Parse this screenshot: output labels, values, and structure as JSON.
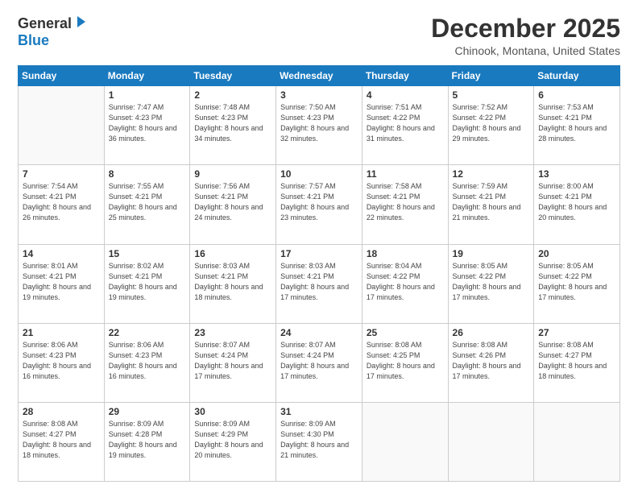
{
  "header": {
    "logo_general": "General",
    "logo_blue": "Blue",
    "month_title": "December 2025",
    "location": "Chinook, Montana, United States"
  },
  "weekdays": [
    "Sunday",
    "Monday",
    "Tuesday",
    "Wednesday",
    "Thursday",
    "Friday",
    "Saturday"
  ],
  "weeks": [
    [
      {
        "day": "",
        "sunrise": "",
        "sunset": "",
        "daylight": ""
      },
      {
        "day": "1",
        "sunrise": "Sunrise: 7:47 AM",
        "sunset": "Sunset: 4:23 PM",
        "daylight": "Daylight: 8 hours and 36 minutes."
      },
      {
        "day": "2",
        "sunrise": "Sunrise: 7:48 AM",
        "sunset": "Sunset: 4:23 PM",
        "daylight": "Daylight: 8 hours and 34 minutes."
      },
      {
        "day": "3",
        "sunrise": "Sunrise: 7:50 AM",
        "sunset": "Sunset: 4:23 PM",
        "daylight": "Daylight: 8 hours and 32 minutes."
      },
      {
        "day": "4",
        "sunrise": "Sunrise: 7:51 AM",
        "sunset": "Sunset: 4:22 PM",
        "daylight": "Daylight: 8 hours and 31 minutes."
      },
      {
        "day": "5",
        "sunrise": "Sunrise: 7:52 AM",
        "sunset": "Sunset: 4:22 PM",
        "daylight": "Daylight: 8 hours and 29 minutes."
      },
      {
        "day": "6",
        "sunrise": "Sunrise: 7:53 AM",
        "sunset": "Sunset: 4:21 PM",
        "daylight": "Daylight: 8 hours and 28 minutes."
      }
    ],
    [
      {
        "day": "7",
        "sunrise": "Sunrise: 7:54 AM",
        "sunset": "Sunset: 4:21 PM",
        "daylight": "Daylight: 8 hours and 26 minutes."
      },
      {
        "day": "8",
        "sunrise": "Sunrise: 7:55 AM",
        "sunset": "Sunset: 4:21 PM",
        "daylight": "Daylight: 8 hours and 25 minutes."
      },
      {
        "day": "9",
        "sunrise": "Sunrise: 7:56 AM",
        "sunset": "Sunset: 4:21 PM",
        "daylight": "Daylight: 8 hours and 24 minutes."
      },
      {
        "day": "10",
        "sunrise": "Sunrise: 7:57 AM",
        "sunset": "Sunset: 4:21 PM",
        "daylight": "Daylight: 8 hours and 23 minutes."
      },
      {
        "day": "11",
        "sunrise": "Sunrise: 7:58 AM",
        "sunset": "Sunset: 4:21 PM",
        "daylight": "Daylight: 8 hours and 22 minutes."
      },
      {
        "day": "12",
        "sunrise": "Sunrise: 7:59 AM",
        "sunset": "Sunset: 4:21 PM",
        "daylight": "Daylight: 8 hours and 21 minutes."
      },
      {
        "day": "13",
        "sunrise": "Sunrise: 8:00 AM",
        "sunset": "Sunset: 4:21 PM",
        "daylight": "Daylight: 8 hours and 20 minutes."
      }
    ],
    [
      {
        "day": "14",
        "sunrise": "Sunrise: 8:01 AM",
        "sunset": "Sunset: 4:21 PM",
        "daylight": "Daylight: 8 hours and 19 minutes."
      },
      {
        "day": "15",
        "sunrise": "Sunrise: 8:02 AM",
        "sunset": "Sunset: 4:21 PM",
        "daylight": "Daylight: 8 hours and 19 minutes."
      },
      {
        "day": "16",
        "sunrise": "Sunrise: 8:03 AM",
        "sunset": "Sunset: 4:21 PM",
        "daylight": "Daylight: 8 hours and 18 minutes."
      },
      {
        "day": "17",
        "sunrise": "Sunrise: 8:03 AM",
        "sunset": "Sunset: 4:21 PM",
        "daylight": "Daylight: 8 hours and 17 minutes."
      },
      {
        "day": "18",
        "sunrise": "Sunrise: 8:04 AM",
        "sunset": "Sunset: 4:22 PM",
        "daylight": "Daylight: 8 hours and 17 minutes."
      },
      {
        "day": "19",
        "sunrise": "Sunrise: 8:05 AM",
        "sunset": "Sunset: 4:22 PM",
        "daylight": "Daylight: 8 hours and 17 minutes."
      },
      {
        "day": "20",
        "sunrise": "Sunrise: 8:05 AM",
        "sunset": "Sunset: 4:22 PM",
        "daylight": "Daylight: 8 hours and 17 minutes."
      }
    ],
    [
      {
        "day": "21",
        "sunrise": "Sunrise: 8:06 AM",
        "sunset": "Sunset: 4:23 PM",
        "daylight": "Daylight: 8 hours and 16 minutes."
      },
      {
        "day": "22",
        "sunrise": "Sunrise: 8:06 AM",
        "sunset": "Sunset: 4:23 PM",
        "daylight": "Daylight: 8 hours and 16 minutes."
      },
      {
        "day": "23",
        "sunrise": "Sunrise: 8:07 AM",
        "sunset": "Sunset: 4:24 PM",
        "daylight": "Daylight: 8 hours and 17 minutes."
      },
      {
        "day": "24",
        "sunrise": "Sunrise: 8:07 AM",
        "sunset": "Sunset: 4:24 PM",
        "daylight": "Daylight: 8 hours and 17 minutes."
      },
      {
        "day": "25",
        "sunrise": "Sunrise: 8:08 AM",
        "sunset": "Sunset: 4:25 PM",
        "daylight": "Daylight: 8 hours and 17 minutes."
      },
      {
        "day": "26",
        "sunrise": "Sunrise: 8:08 AM",
        "sunset": "Sunset: 4:26 PM",
        "daylight": "Daylight: 8 hours and 17 minutes."
      },
      {
        "day": "27",
        "sunrise": "Sunrise: 8:08 AM",
        "sunset": "Sunset: 4:27 PM",
        "daylight": "Daylight: 8 hours and 18 minutes."
      }
    ],
    [
      {
        "day": "28",
        "sunrise": "Sunrise: 8:08 AM",
        "sunset": "Sunset: 4:27 PM",
        "daylight": "Daylight: 8 hours and 18 minutes."
      },
      {
        "day": "29",
        "sunrise": "Sunrise: 8:09 AM",
        "sunset": "Sunset: 4:28 PM",
        "daylight": "Daylight: 8 hours and 19 minutes."
      },
      {
        "day": "30",
        "sunrise": "Sunrise: 8:09 AM",
        "sunset": "Sunset: 4:29 PM",
        "daylight": "Daylight: 8 hours and 20 minutes."
      },
      {
        "day": "31",
        "sunrise": "Sunrise: 8:09 AM",
        "sunset": "Sunset: 4:30 PM",
        "daylight": "Daylight: 8 hours and 21 minutes."
      },
      {
        "day": "",
        "sunrise": "",
        "sunset": "",
        "daylight": ""
      },
      {
        "day": "",
        "sunrise": "",
        "sunset": "",
        "daylight": ""
      },
      {
        "day": "",
        "sunrise": "",
        "sunset": "",
        "daylight": ""
      }
    ]
  ]
}
